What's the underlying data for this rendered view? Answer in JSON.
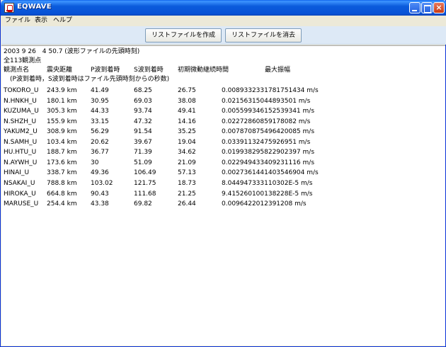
{
  "window": {
    "title": "EQWAVE",
    "controls": {
      "minimize": "",
      "maximize": "",
      "close": "×"
    }
  },
  "menu": [
    "ファイル",
    "表示",
    "ヘルプ"
  ],
  "toolbar": {
    "create_label": "リストファイルを作成",
    "delete_label": "リストファイルを消去"
  },
  "content": {
    "header_time": "2003 9 26　4 50.7 (波形ファイルの先頭時刻)",
    "station_count": "全113観測点",
    "columns": [
      "観測点名",
      "震央距離",
      "P波到着時",
      "S波到着時",
      "初期微動継続時間",
      "最大振幅"
    ],
    "note": "(P波到着時，S波到着時はファイル先頭時刻からの秒数)",
    "rows": [
      [
        "TOKORO_U",
        "243.9 km",
        "41.49",
        "68.25",
        "26.75",
        "0.008933233178175143​4 m/s"
      ],
      [
        "N.HNKH_U",
        "180.1 km",
        "30.95",
        "69.03",
        "38.08",
        "0.02156315044893501 m/s"
      ],
      [
        "KUZUMA_U",
        "305.3 km",
        "44.33",
        "93.74",
        "49.41",
        "0.005599346152539341 m/s"
      ],
      [
        "N.SHZH_U",
        "155.9 km",
        "33.15",
        "47.32",
        "14.16",
        "0.022728608591780​82 m/s"
      ],
      [
        "YAKUM2_U",
        "308.9 km",
        "56.29",
        "91.54",
        "35.25",
        "0.007870875496420085 m/s"
      ],
      [
        "N.SAMH_U",
        "103.4 km",
        "20.62",
        "39.67",
        "19.04",
        "0.03391132475926951 m/s"
      ],
      [
        "HU.HTU_U",
        "188.7 km",
        "36.77",
        "71.39",
        "34.62",
        "0.019938295822902397 m/s"
      ],
      [
        "N.AYWH_U",
        "173.6 km",
        "30",
        "51.09",
        "21.09",
        "0.022949433409231116 m/s"
      ],
      [
        "HINAI_U",
        "338.7 km",
        "49.36",
        "106.49",
        "57.13",
        "0.0027361441403546904 m/s"
      ],
      [
        "NSAKAI_U",
        "788.8 km",
        "103.02",
        "121.75",
        "18.73",
        "8.044947333110302E-5 m/s"
      ],
      [
        "HIROKA_U",
        "664.8 km",
        "90.43",
        "111.68",
        "21.25",
        "9.415260100138228E-5 m/s"
      ],
      [
        "MARUSE_U",
        "254.4 km",
        "43.38",
        "69.82",
        "26.44",
        "0.0096422012391208 m/s"
      ]
    ]
  }
}
